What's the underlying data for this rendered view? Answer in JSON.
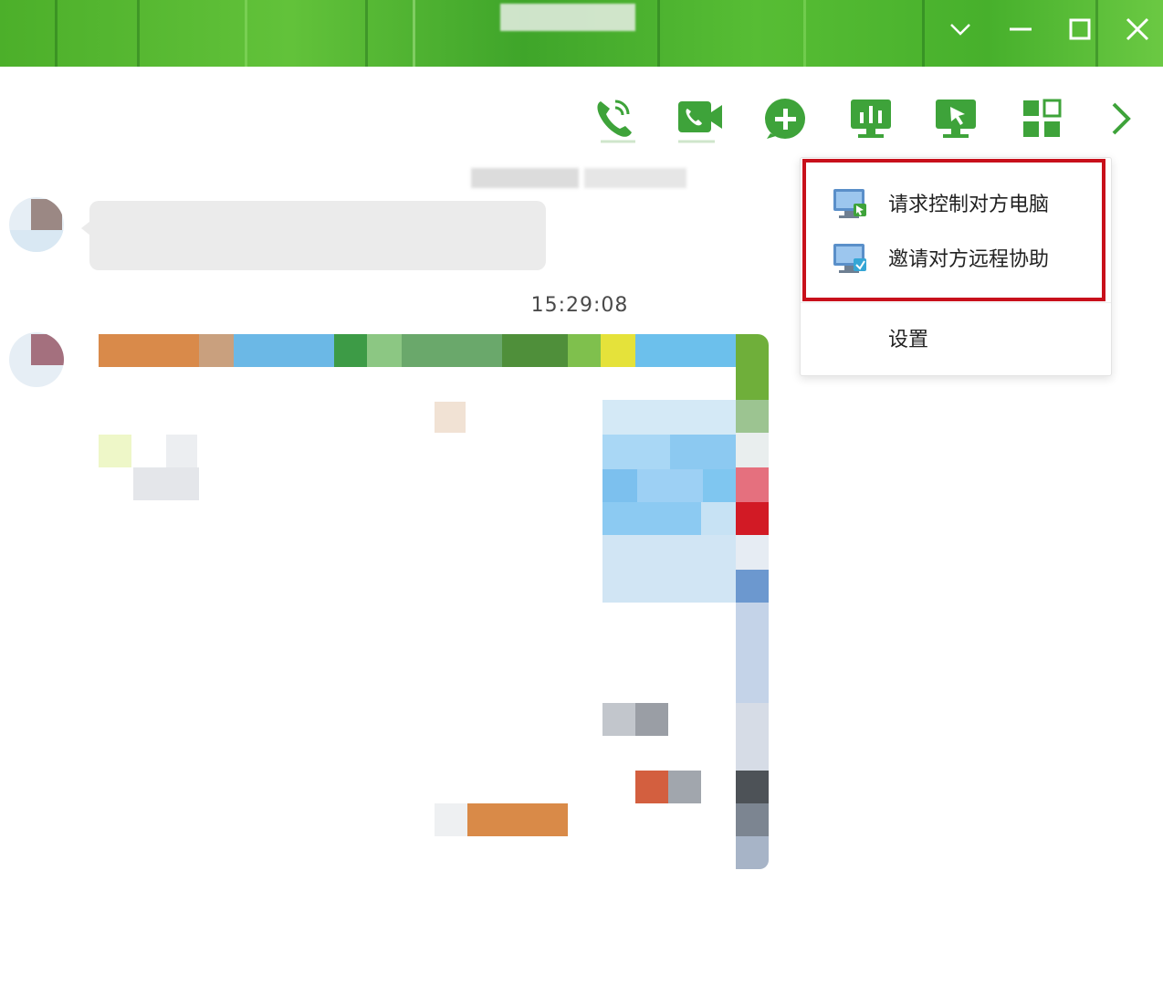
{
  "toolbar": {
    "icons": [
      "phone-call-icon",
      "video-call-icon",
      "add-icon",
      "screen-share-icon",
      "remote-desktop-icon",
      "app-grid-icon",
      "chevron-right-icon"
    ]
  },
  "chat": {
    "timestamp": "15:29:08"
  },
  "remote_menu": {
    "items": [
      {
        "label": "请求控制对方电脑",
        "icon": "request-control-icon"
      },
      {
        "label": "邀请对方远程协助",
        "icon": "invite-assist-icon"
      },
      {
        "label": "设置",
        "icon": ""
      }
    ]
  },
  "colors": {
    "accent": "#3ea33a",
    "titlebar": "#4caf2a",
    "highlight": "#c8101b"
  }
}
